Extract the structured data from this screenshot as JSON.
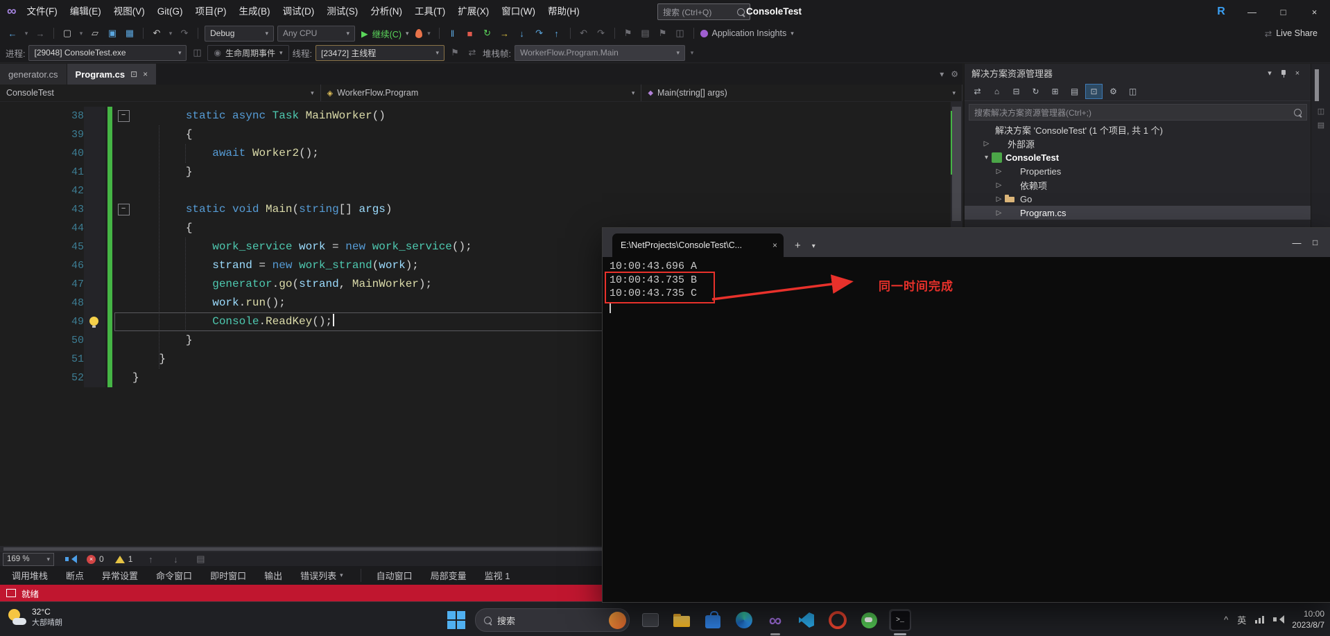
{
  "colors": {
    "accent-red": "#e8312b",
    "status-red": "#c0162f",
    "change-green": "#45b545",
    "kw": "#569cd6",
    "type": "#4ec9b0",
    "method": "#dcdcaa",
    "var": "#9cdcfe"
  },
  "icons": {
    "dropdown": "▾",
    "back": "←",
    "forward": "→",
    "undo": "↶",
    "redo": "↷",
    "play": "▶",
    "pause": "‖",
    "stop": "■",
    "restart": "↻",
    "show-next": "→",
    "step-into": "↓",
    "step-out": "↑",
    "step-over": "↷",
    "close": "×",
    "plus": "+",
    "minimize": "—",
    "maximize": "□",
    "save": "▣",
    "save-all": "▦",
    "new-file": "▢",
    "open": "▱",
    "bookmark": "⚑",
    "list": "▤",
    "window": "◫",
    "boxdot": "⊡",
    "gear": "⚙",
    "sync": "⇄",
    "home": "⌂",
    "collapse": "⊟",
    "expand": "⊞",
    "live-share": "⇄",
    "lifecycle": "◉",
    "fold-minus": "−",
    "expander-collapsed": "▷",
    "expander-expanded": "▾",
    "terminal_glyph": ">_",
    "bc_class": "◈",
    "bc_method": "◆",
    "caret-up": "^"
  },
  "titlebar": {
    "menus": [
      "文件(F)",
      "编辑(E)",
      "视图(V)",
      "Git(G)",
      "项目(P)",
      "生成(B)",
      "调试(D)",
      "测试(S)",
      "分析(N)",
      "工具(T)",
      "扩展(X)",
      "窗口(W)",
      "帮助(H)"
    ],
    "search_placeholder": "搜索 (Ctrl+Q)",
    "solution_name": "ConsoleTest",
    "r_badge": "R"
  },
  "toolbar": {
    "debug_target": "Debug",
    "platform": "Any CPU",
    "continue_label": "继续(C)",
    "app_insights_label": "Application Insights",
    "live_share_label": "Live Share"
  },
  "debugbar": {
    "process_label": "进程:",
    "process_value": "[29048] ConsoleTest.exe",
    "lifecycle_label": "生命周期事件",
    "thread_label": "线程:",
    "thread_value": "[23472] 主线程",
    "stackframe_label": "堆栈帧:",
    "stackframe_value": "WorkerFlow.Program.Main"
  },
  "editor": {
    "tabs": [
      {
        "label": "generator.cs",
        "active": false
      },
      {
        "label": "Program.cs",
        "active": true
      }
    ],
    "breadcrumb": [
      {
        "label": "ConsoleTest"
      },
      {
        "label": "WorkerFlow.Program"
      },
      {
        "label": "Main(string[] args)"
      }
    ],
    "zoom": "169 %",
    "error_count": "0",
    "warning_count": "1",
    "code_lines": [
      {
        "n": 38,
        "indent": 8,
        "fold": true,
        "seg": [
          [
            "k",
            "static"
          ],
          [
            "p",
            " "
          ],
          [
            "k",
            "async"
          ],
          [
            "p",
            " "
          ],
          [
            "t",
            "Task"
          ],
          [
            "p",
            " "
          ],
          [
            "m",
            "MainWorker"
          ],
          [
            "p",
            "()"
          ]
        ]
      },
      {
        "n": 39,
        "indent": 8,
        "seg": [
          [
            "p",
            "{"
          ]
        ]
      },
      {
        "n": 40,
        "indent": 12,
        "seg": [
          [
            "k",
            "await"
          ],
          [
            "p",
            " "
          ],
          [
            "m",
            "Worker2"
          ],
          [
            "p",
            "();"
          ]
        ]
      },
      {
        "n": 41,
        "indent": 8,
        "seg": [
          [
            "p",
            "}"
          ]
        ]
      },
      {
        "n": 42,
        "indent": 0,
        "seg": []
      },
      {
        "n": 43,
        "indent": 8,
        "fold": true,
        "seg": [
          [
            "k",
            "static"
          ],
          [
            "p",
            " "
          ],
          [
            "k",
            "void"
          ],
          [
            "p",
            " "
          ],
          [
            "m",
            "Main"
          ],
          [
            "p",
            "("
          ],
          [
            "k",
            "string"
          ],
          [
            "p",
            "[] "
          ],
          [
            "v",
            "args"
          ],
          [
            "p",
            ")"
          ]
        ]
      },
      {
        "n": 44,
        "indent": 8,
        "seg": [
          [
            "p",
            "{"
          ]
        ]
      },
      {
        "n": 45,
        "indent": 12,
        "seg": [
          [
            "t",
            "work_service"
          ],
          [
            "p",
            " "
          ],
          [
            "v",
            "work"
          ],
          [
            "p",
            " = "
          ],
          [
            "k",
            "new"
          ],
          [
            "p",
            " "
          ],
          [
            "t",
            "work_service"
          ],
          [
            "p",
            "();"
          ]
        ]
      },
      {
        "n": 46,
        "indent": 12,
        "seg": [
          [
            "v",
            "strand"
          ],
          [
            "p",
            " = "
          ],
          [
            "k",
            "new"
          ],
          [
            "p",
            " "
          ],
          [
            "t",
            "work_strand"
          ],
          [
            "p",
            "("
          ],
          [
            "v",
            "work"
          ],
          [
            "p",
            ");"
          ]
        ]
      },
      {
        "n": 47,
        "indent": 12,
        "seg": [
          [
            "t",
            "generator"
          ],
          [
            "p",
            "."
          ],
          [
            "m",
            "go"
          ],
          [
            "p",
            "("
          ],
          [
            "v",
            "strand"
          ],
          [
            "p",
            ", "
          ],
          [
            "m",
            "MainWorker"
          ],
          [
            "p",
            ");"
          ]
        ]
      },
      {
        "n": 48,
        "indent": 12,
        "seg": [
          [
            "v",
            "work"
          ],
          [
            "p",
            "."
          ],
          [
            "m",
            "run"
          ],
          [
            "p",
            "();"
          ]
        ]
      },
      {
        "n": 49,
        "indent": 12,
        "current": true,
        "bulb": true,
        "caret": true,
        "seg": [
          [
            "t",
            "Console"
          ],
          [
            "p",
            "."
          ],
          [
            "m",
            "ReadKey"
          ],
          [
            "p",
            "();"
          ]
        ]
      },
      {
        "n": 50,
        "indent": 8,
        "seg": [
          [
            "p",
            "}"
          ]
        ]
      },
      {
        "n": 51,
        "indent": 4,
        "seg": [
          [
            "p",
            "}"
          ]
        ]
      },
      {
        "n": 52,
        "indent": 0,
        "seg": [
          [
            "p",
            "}"
          ]
        ]
      }
    ]
  },
  "panel_tabs": [
    {
      "label": "调用堆栈"
    },
    {
      "label": "断点"
    },
    {
      "label": "异常设置"
    },
    {
      "label": "命令窗口"
    },
    {
      "label": "即时窗口"
    },
    {
      "label": "输出"
    },
    {
      "label": "错误列表",
      "dropdown": true
    },
    {
      "label": "自动窗口",
      "gap": true
    },
    {
      "label": "局部变量"
    },
    {
      "label": "监视 1"
    }
  ],
  "statusbar": {
    "ready": "就绪"
  },
  "terminal": {
    "tab_title": "E:\\NetProjects\\ConsoleTest\\C...",
    "lines": [
      "10:00:43.696 A",
      "10:00:43.735 B",
      "10:00:43.735 C"
    ],
    "annotation": "同一时间完成"
  },
  "solution_explorer": {
    "title": "解决方案资源管理器",
    "search_placeholder": "搜索解决方案资源管理器(Ctrl+;)",
    "toolbar_icons": [
      {
        "name": "switch-views-icon",
        "glyph": "⇄"
      },
      {
        "name": "home-icon",
        "glyph": "⌂"
      },
      {
        "name": "collapse-all-icon",
        "glyph": "⊟"
      },
      {
        "name": "refresh-icon",
        "glyph": "↻"
      },
      {
        "name": "show-all-files-icon",
        "glyph": "⊞"
      },
      {
        "name": "view-code-icon",
        "glyph": "▤"
      },
      {
        "name": "sync-with-active-document-icon",
        "glyph": "⊡",
        "active": true
      },
      {
        "name": "properties-icon",
        "glyph": "⚙"
      },
      {
        "name": "preview-icon",
        "glyph": "◫"
      }
    ],
    "tree": [
      {
        "label": "解决方案 'ConsoleTest' (1 个项目, 共 1 个)",
        "icon": "solution",
        "indent": 0,
        "expander": ""
      },
      {
        "label": "外部源",
        "icon": "external",
        "indent": 1,
        "expander": "collapsed"
      },
      {
        "label": "ConsoleTest",
        "icon": "project",
        "indent": 1,
        "expander": "expanded",
        "bold": true
      },
      {
        "label": "Properties",
        "icon": "properties",
        "indent": 2,
        "expander": "collapsed"
      },
      {
        "label": "依赖项",
        "icon": "dependencies",
        "indent": 2,
        "expander": "collapsed"
      },
      {
        "label": "Go",
        "icon": "folder",
        "indent": 2,
        "expander": "collapsed"
      },
      {
        "label": "Program.cs",
        "icon": "csfile",
        "indent": 2,
        "expander": "collapsed",
        "selected": true
      }
    ]
  },
  "taskbar": {
    "weather_temp": "32°C",
    "weather_desc": "大部晴朗",
    "search_label": "搜索",
    "apps": [
      {
        "name": "task-view"
      },
      {
        "name": "file-explorer"
      },
      {
        "name": "store"
      },
      {
        "name": "edge"
      },
      {
        "name": "visual-studio",
        "running": true
      },
      {
        "name": "vscode"
      },
      {
        "name": "opera"
      },
      {
        "name": "chat"
      },
      {
        "name": "terminal",
        "running": true,
        "active": true
      }
    ],
    "tray_lang": "英",
    "time": "10:00",
    "date": "2023/8/7"
  }
}
